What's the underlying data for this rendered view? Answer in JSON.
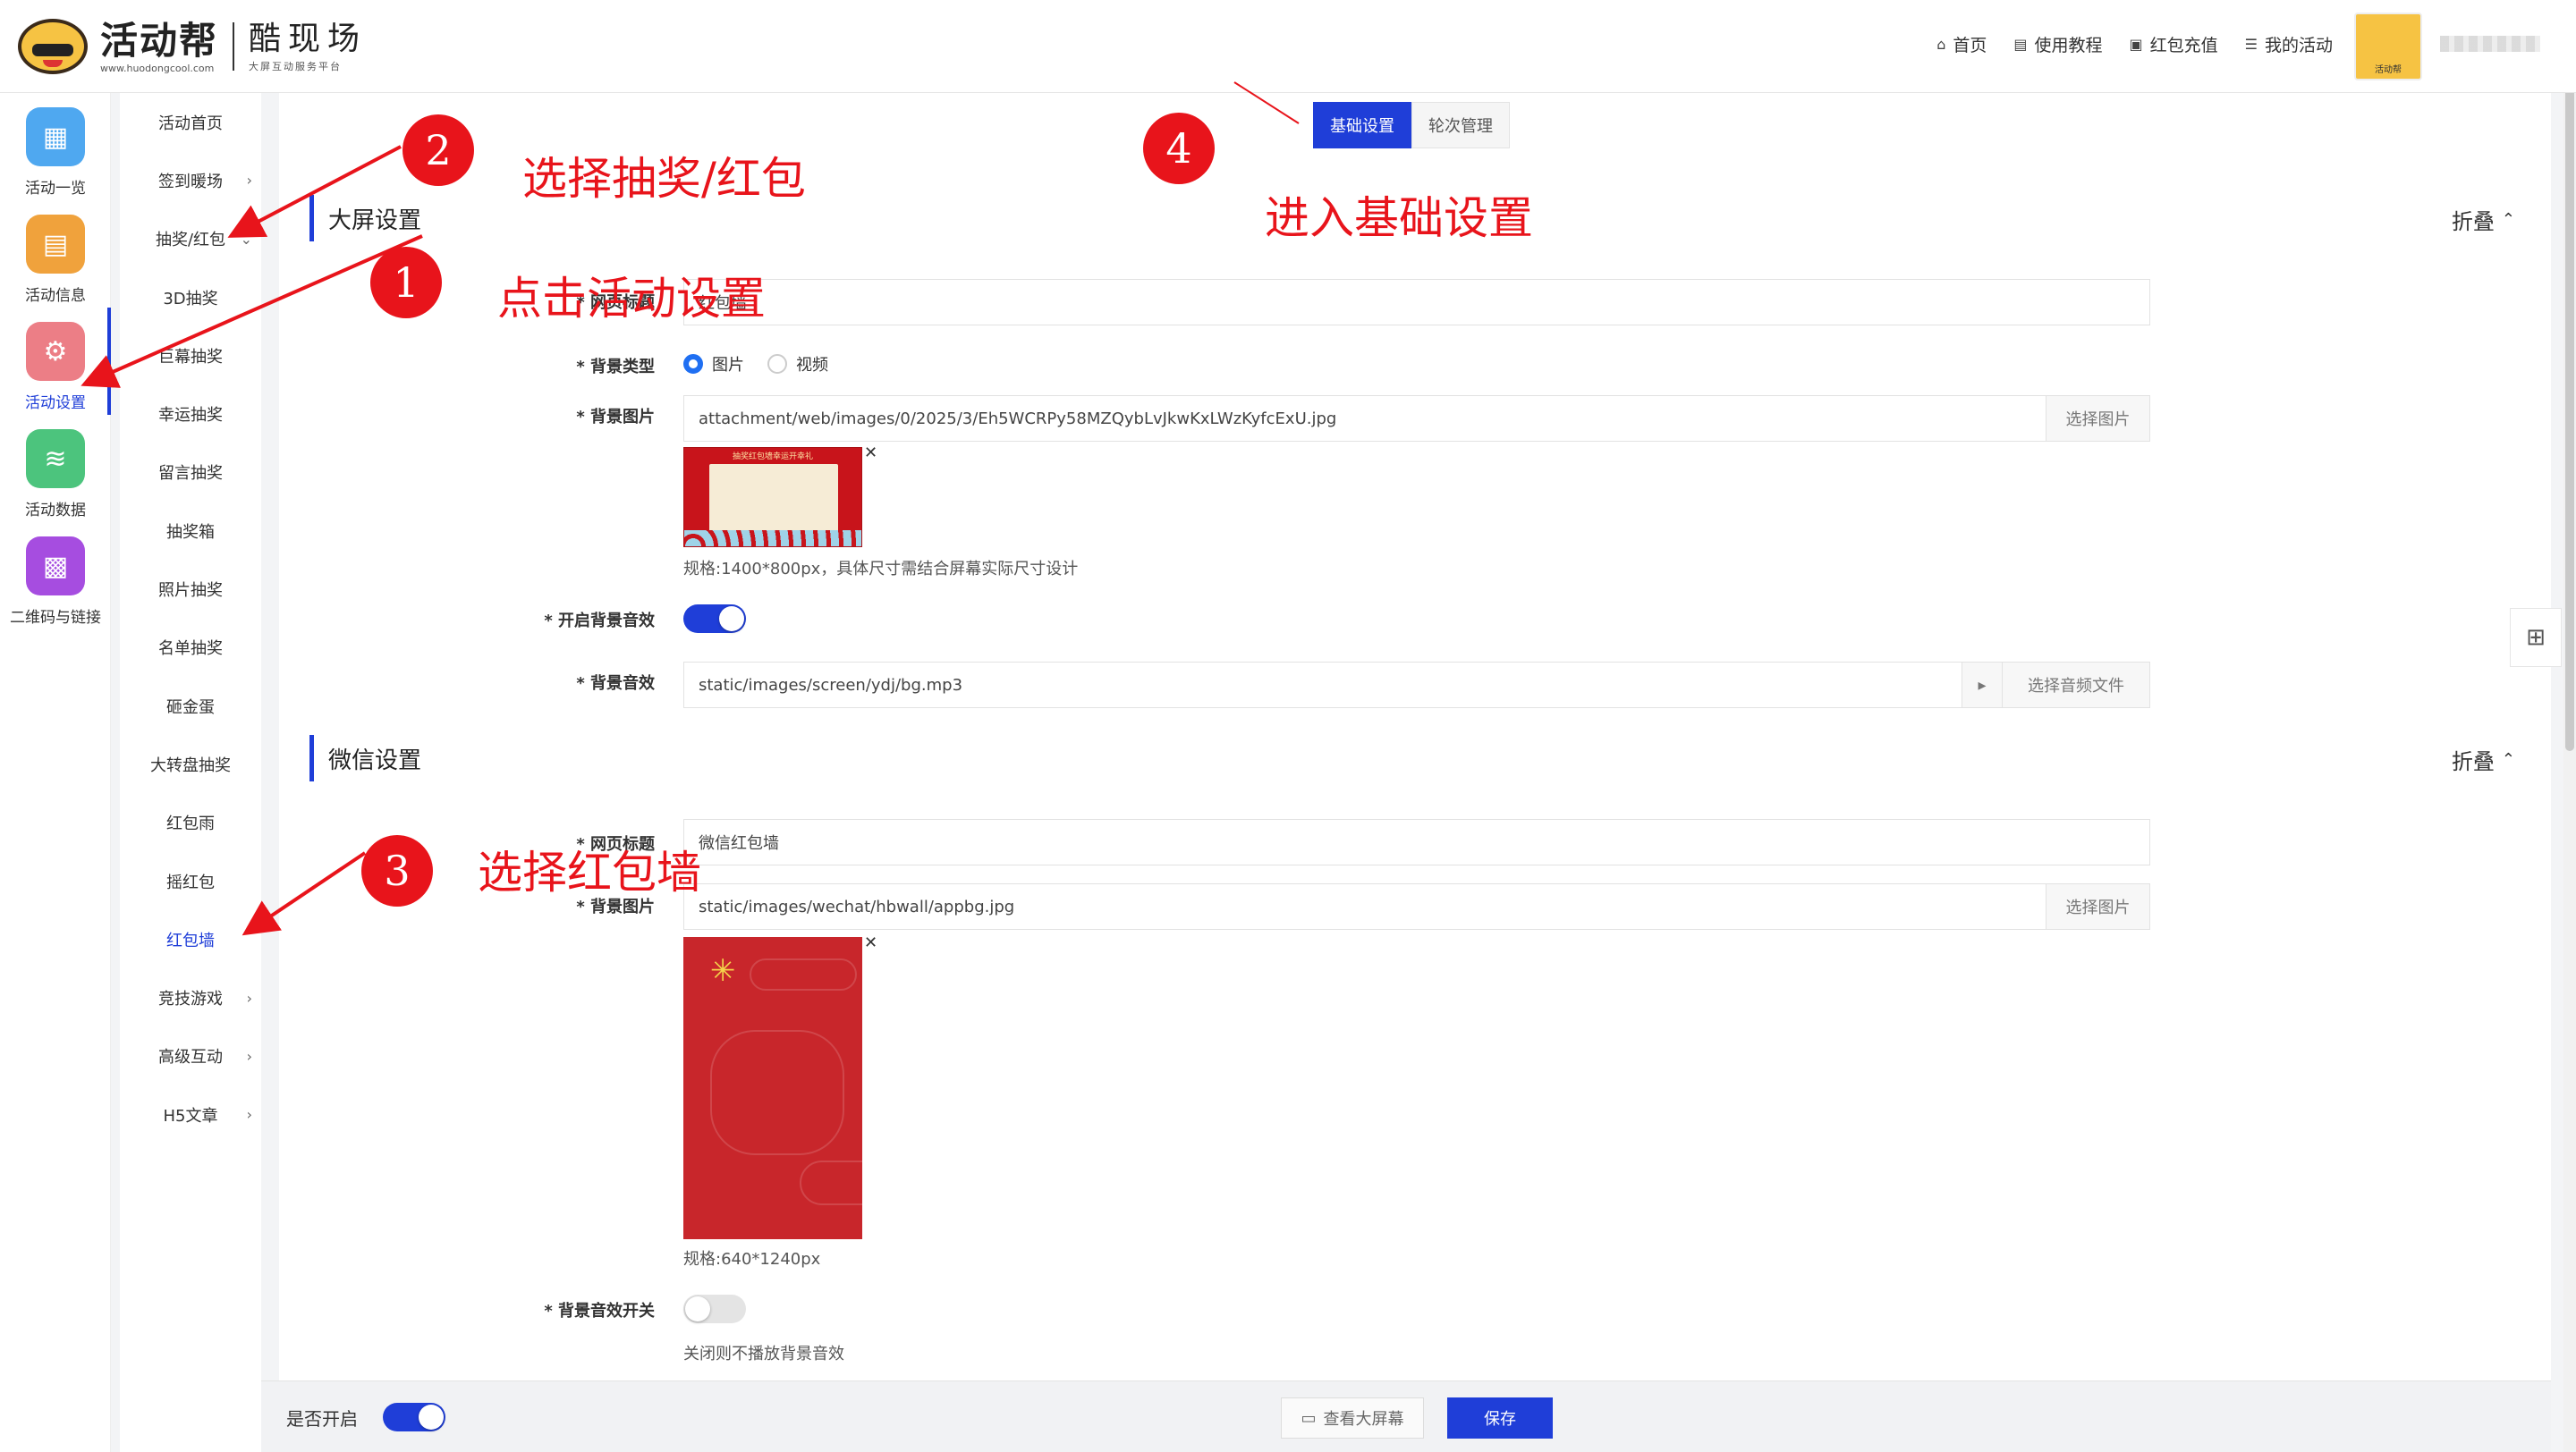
{
  "logo": {
    "name": "活动帮",
    "url": "www.huodongcool.com",
    "brand": "酷现场",
    "slogan": "大屏互动服务平台"
  },
  "topnav": [
    {
      "icon": "home-icon",
      "label": "首页"
    },
    {
      "icon": "book-icon",
      "label": "使用教程"
    },
    {
      "icon": "wallet-icon",
      "label": "红包充值"
    },
    {
      "icon": "list-icon",
      "label": "我的活动"
    }
  ],
  "avatar_caption": "活动帮",
  "iconbar": [
    {
      "icon": "grid-icon",
      "label": "活动一览",
      "color": "#4fa8f0"
    },
    {
      "icon": "document-icon",
      "label": "活动信息",
      "color": "#f0a23c"
    },
    {
      "icon": "gear-icon",
      "label": "活动设置",
      "color": "#ec7e86",
      "active": true
    },
    {
      "icon": "database-icon",
      "label": "活动数据",
      "color": "#4cc47d"
    },
    {
      "icon": "qrcode-icon",
      "label": "二维码与链接",
      "color": "#a64de0"
    }
  ],
  "submenu": [
    {
      "label": "活动首页",
      "arrow": ""
    },
    {
      "label": "签到暖场",
      "arrow": "›"
    },
    {
      "label": "抽奖/红包",
      "arrow": "⌄"
    },
    {
      "label": "3D抽奖",
      "arrow": ""
    },
    {
      "label": "巨幕抽奖",
      "arrow": ""
    },
    {
      "label": "幸运抽奖",
      "arrow": ""
    },
    {
      "label": "留言抽奖",
      "arrow": ""
    },
    {
      "label": "抽奖箱",
      "arrow": ""
    },
    {
      "label": "照片抽奖",
      "arrow": ""
    },
    {
      "label": "名单抽奖",
      "arrow": ""
    },
    {
      "label": "砸金蛋",
      "arrow": ""
    },
    {
      "label": "大转盘抽奖",
      "arrow": ""
    },
    {
      "label": "红包雨",
      "arrow": ""
    },
    {
      "label": "摇红包",
      "arrow": ""
    },
    {
      "label": "红包墙",
      "arrow": "",
      "active": true
    },
    {
      "label": "竞技游戏",
      "arrow": "›"
    },
    {
      "label": "高级互动",
      "arrow": "›"
    },
    {
      "label": "H5文章",
      "arrow": "›"
    }
  ],
  "tabs": {
    "basic": "基础设置",
    "rounds": "轮次管理"
  },
  "screen_section": {
    "title": "大屏设置",
    "fold": "折叠",
    "page_title_label": "* 网页标题",
    "page_title_value": "红包墙",
    "bg_type_label": "* 背景类型",
    "bg_type_options": [
      "图片",
      "视频"
    ],
    "bg_image_label": "* 背景图片",
    "bg_image_value": "attachment/web/images/0/2025/3/Eh5WCRPy58MZQybLvJkwKxLWzKyfcExU.jpg",
    "choose_image": "选择图片",
    "thumb_caption": "抽奖红包墙幸运开幸礼",
    "bg_image_hint": "规格:1400*800px，具体尺寸需结合屏幕实际尺寸设计",
    "bg_music_switch_label": "* 开启背景音效",
    "bg_music_label": "* 背景音效",
    "bg_music_value": "static/images/screen/ydj/bg.mp3",
    "choose_audio": "选择音频文件"
  },
  "wechat_section": {
    "title": "微信设置",
    "fold": "折叠",
    "page_title_label": "* 网页标题",
    "page_title_value": "微信红包墙",
    "bg_image_label": "* 背景图片",
    "bg_image_value": "static/images/wechat/hbwall/appbg.jpg",
    "choose_image": "选择图片",
    "bg_image_hint": "规格:640*1240px",
    "bg_music_switch_label": "* 背景音效开关",
    "bg_music_hint": "关闭则不播放背景音效"
  },
  "footer": {
    "enable_label": "是否开启",
    "view_screen": "查看大屏幕",
    "save": "保存"
  },
  "annotations": {
    "n1": "1",
    "t1": "点击活动设置",
    "n2": "2",
    "t2": "选择抽奖/红包",
    "n3": "3",
    "t3": "选择红包墙",
    "n4": "4",
    "t4": "进入基础设置"
  },
  "colors": {
    "accent": "#1f3ed8",
    "annotation": "#e8141b"
  }
}
